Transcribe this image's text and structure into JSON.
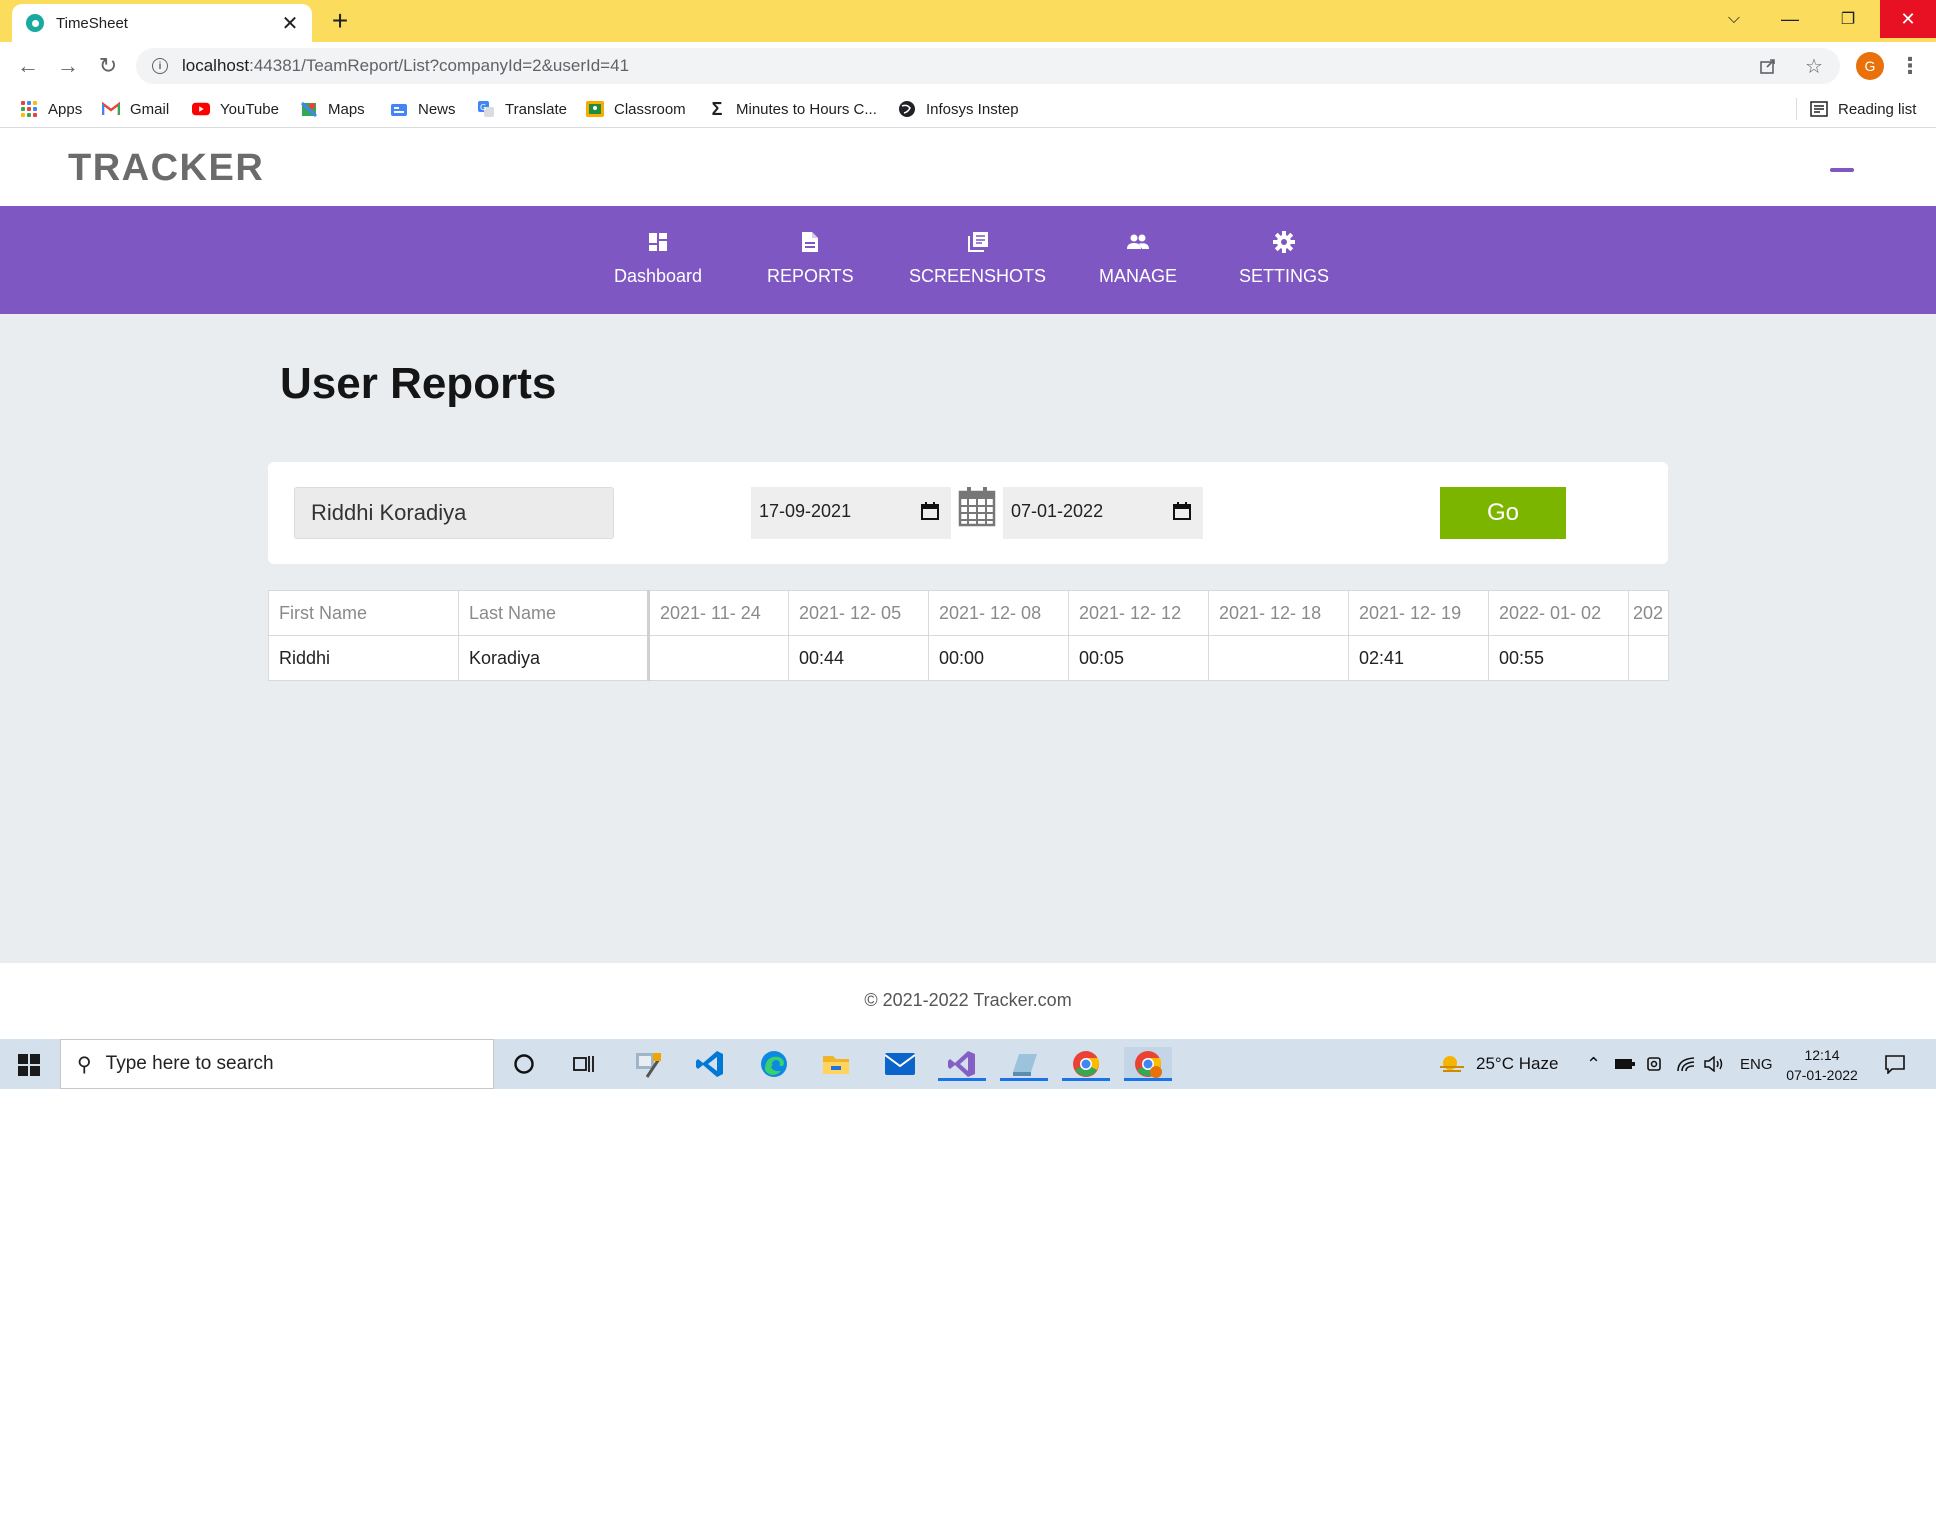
{
  "browser": {
    "tab_title": "TimeSheet",
    "new_tab": "+",
    "url_host": "localhost",
    "url_path": ":44381/TeamReport/List?companyId=2&userId=41",
    "profile_initial": "G",
    "bookmarks": [
      {
        "label": "Apps",
        "icon": "apps-grid-icon"
      },
      {
        "label": "Gmail",
        "icon": "gmail-icon"
      },
      {
        "label": "YouTube",
        "icon": "youtube-icon"
      },
      {
        "label": "Maps",
        "icon": "maps-icon"
      },
      {
        "label": "News",
        "icon": "news-icon"
      },
      {
        "label": "Translate",
        "icon": "translate-icon"
      },
      {
        "label": "Classroom",
        "icon": "classroom-icon"
      },
      {
        "label": "Minutes to Hours C...",
        "icon": "sigma-icon"
      },
      {
        "label": "Infosys Instep",
        "icon": "globe-icon"
      }
    ],
    "reading_list": "Reading list"
  },
  "site": {
    "brand": "TRACKER",
    "nav": [
      {
        "label": "Dashboard",
        "icon": "dashboard-icon"
      },
      {
        "label": "REPORTS",
        "icon": "document-icon"
      },
      {
        "label": "SCREENSHOTS",
        "icon": "screenshots-icon"
      },
      {
        "label": "MANAGE",
        "icon": "people-icon"
      },
      {
        "label": "SETTINGS",
        "icon": "gear-icon"
      }
    ],
    "page_title": "User Reports",
    "filters": {
      "user": "Riddhi Koradiya",
      "start_date": "17-09-2021",
      "end_date": "07-01-2022",
      "go_label": "Go"
    },
    "table": {
      "headers": [
        "First Name",
        "Last Name",
        "2021- 11- 24",
        "2021- 12- 05",
        "2021- 12- 08",
        "2021- 12- 12",
        "2021- 12- 18",
        "2021- 12- 19",
        "2022- 01- 02",
        "202"
      ],
      "rows": [
        [
          "Riddhi",
          "Koradiya",
          "",
          "00:44",
          "00:00",
          "00:05",
          "",
          "02:41",
          "00:55",
          ""
        ]
      ]
    },
    "footer": "© 2021-2022 Tracker.com"
  },
  "taskbar": {
    "search_placeholder": "Type here to search",
    "weather": "25°C  Haze",
    "language": "ENG",
    "time": "12:14",
    "date": "07-01-2022",
    "accent": "#1a73e8"
  },
  "colors": {
    "nav_bg": "#7e57c2",
    "go_button": "#7cb500",
    "tab_strip": "#fcdc5c"
  }
}
